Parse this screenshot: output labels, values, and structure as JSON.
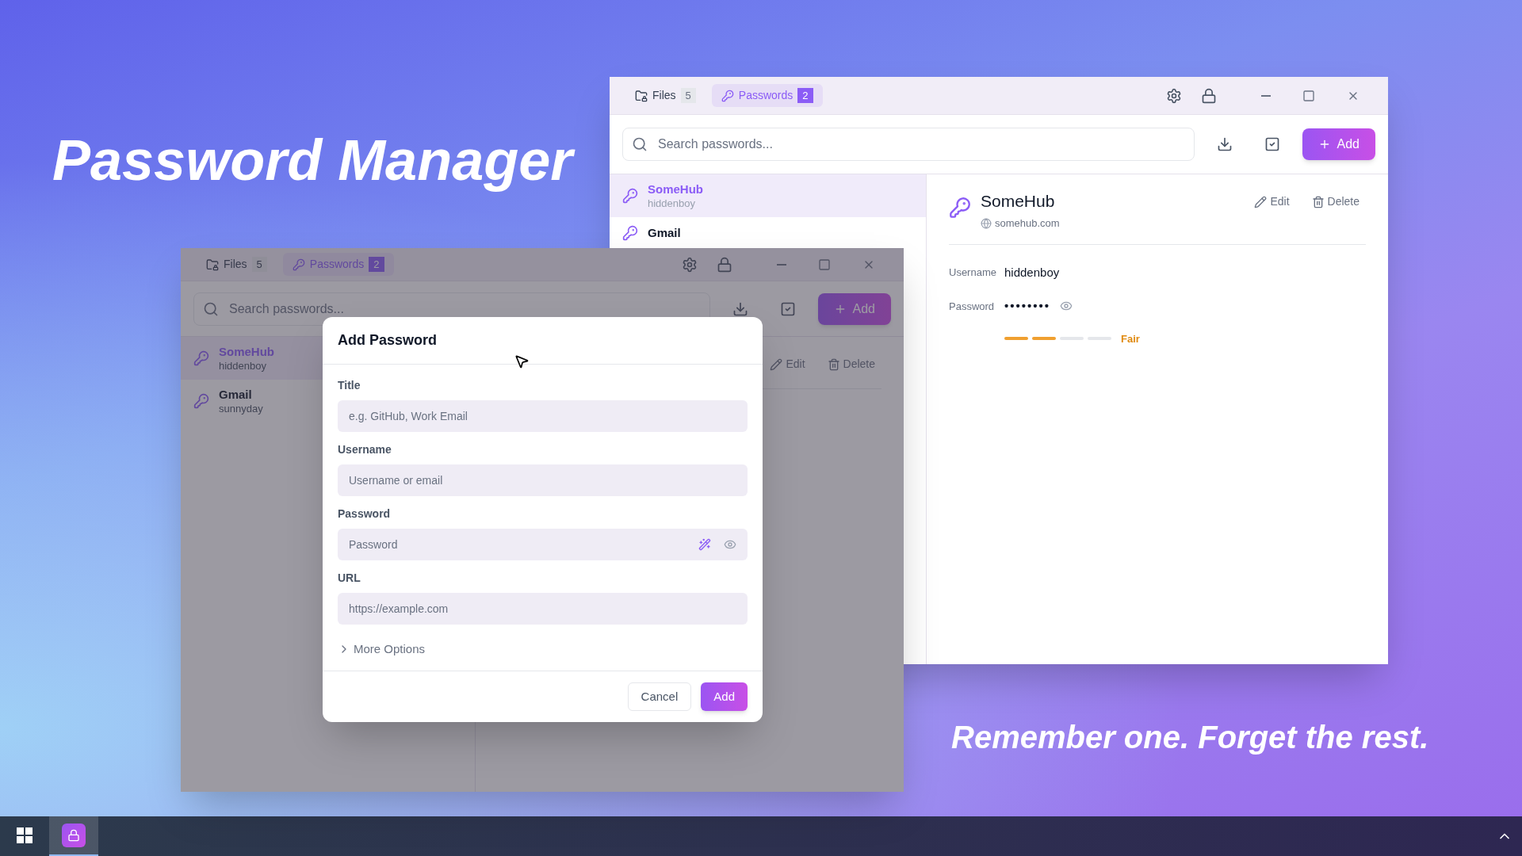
{
  "headline": "Password Manager",
  "tagline": "Remember one. Forget the rest.",
  "windows": [
    {
      "dimmed": false,
      "tabs": [
        {
          "label": "Files",
          "count": "5",
          "kind": "files",
          "selected": false
        },
        {
          "label": "Passwords",
          "count": "2",
          "kind": "passwords",
          "selected": true
        }
      ],
      "search": {
        "placeholder": "Search passwords..."
      },
      "add_button": "Add",
      "entries": [
        {
          "title": "SomeHub",
          "username": "hiddenboy",
          "selected": true
        },
        {
          "title": "Gmail",
          "selected": false
        }
      ],
      "detail": {
        "title": "SomeHub",
        "url": "somehub.com",
        "edit": "Edit",
        "delete": "Delete",
        "fields": [
          {
            "label": "Username",
            "value": "hiddenboy",
            "kind": "text"
          },
          {
            "label": "Password",
            "value": "••••••••",
            "kind": "password"
          }
        ],
        "strength": {
          "level": 0.5,
          "label": "Fair"
        }
      }
    },
    {
      "dimmed": true,
      "tabs": [
        {
          "label": "Files",
          "count": "5",
          "kind": "files",
          "selected": false
        },
        {
          "label": "Passwords",
          "count": "2",
          "kind": "passwords",
          "selected": true
        }
      ],
      "search": {
        "placeholder": "Search passwords..."
      },
      "add_button": "Add",
      "entries": [
        {
          "title": "SomeHub",
          "username": "hiddenboy",
          "selected": true
        },
        {
          "title": "Gmail",
          "username": "sunnyday",
          "selected": false
        }
      ],
      "detail": {
        "edit": "Edit",
        "delete": "Delete"
      }
    }
  ],
  "dialog": {
    "title": "Add Password",
    "fields": [
      {
        "label": "Title",
        "placeholder": "e.g. GitHub, Work Email",
        "kind": "text"
      },
      {
        "label": "Username",
        "placeholder": "Username or email",
        "kind": "text"
      },
      {
        "label": "Password",
        "placeholder": "Password",
        "kind": "password"
      },
      {
        "label": "URL",
        "placeholder": "https://example.com",
        "kind": "text"
      }
    ],
    "more_options": {
      "label": "More Options",
      "expanded": false
    },
    "cancel": "Cancel",
    "submit": "Add"
  },
  "taskbar": {
    "items": [
      {
        "kind": "start",
        "selected": false
      },
      {
        "kind": "app",
        "selected": true
      }
    ]
  }
}
